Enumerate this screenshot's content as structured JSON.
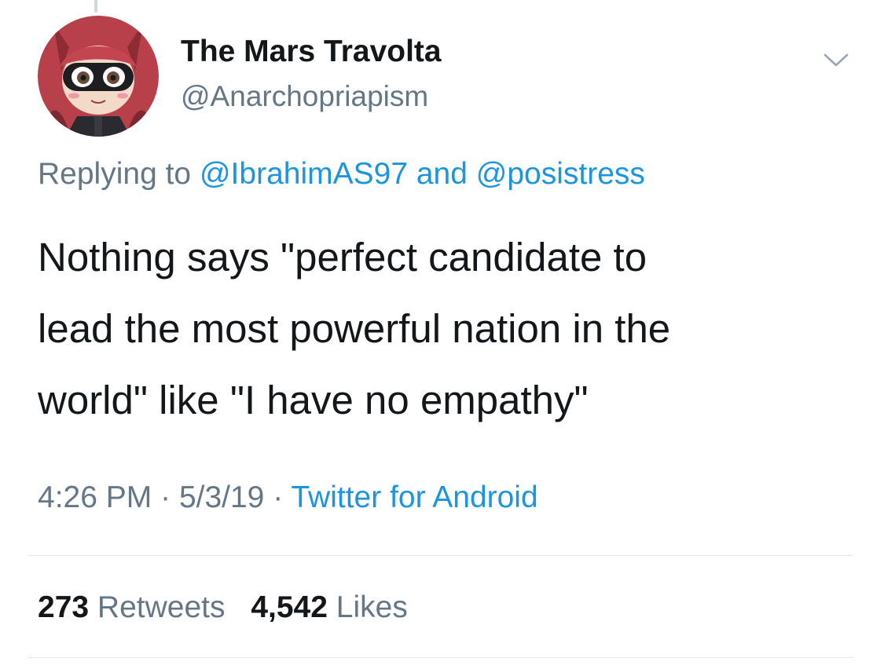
{
  "tweet": {
    "author": {
      "display_name": "The Mars Travolta",
      "handle": "@Anarchopriapism"
    },
    "reply": {
      "prefix": "Replying to",
      "mention_1": "@IbrahimAS97",
      "joiner": "and",
      "mention_2": "@posistress"
    },
    "text_lines": [
      "Nothing says \"perfect candidate to",
      "lead the most powerful nation in the",
      "world\" like \"I have no empathy\""
    ],
    "meta": {
      "time": "4:26 PM",
      "separator": "·",
      "date": "5/3/19",
      "source": "Twitter for Android"
    },
    "stats": {
      "retweets_count": "273",
      "retweets_label": "Retweets",
      "likes_count": "4,542",
      "likes_label": "Likes"
    }
  },
  "icons": {
    "options": "chevron-down-icon"
  },
  "colors": {
    "text_primary": "#14171a",
    "text_secondary": "#657786",
    "link": "#1b95e0",
    "divider": "#e1e8ed"
  }
}
